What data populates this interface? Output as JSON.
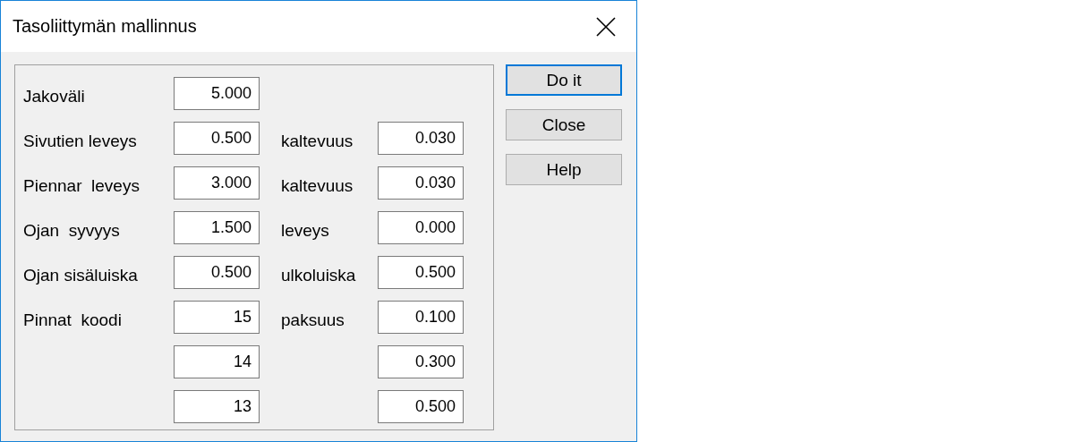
{
  "window": {
    "title": "Tasoliittymän mallinnus"
  },
  "rows": [
    {
      "label": "Jakoväli",
      "value": "5.000"
    },
    {
      "label": "Sivutien leveys",
      "value": "0.500",
      "label2": "kaltevuus",
      "value2": "0.030"
    },
    {
      "label": "Piennar  leveys",
      "value": "3.000",
      "label2": "kaltevuus",
      "value2": "0.030"
    },
    {
      "label": "Ojan  syvyys",
      "value": "1.500",
      "label2": "leveys",
      "value2": "0.000"
    },
    {
      "label": "Ojan sisäluiska",
      "value": "0.500",
      "label2": "ulkoluiska",
      "value2": "0.500"
    },
    {
      "label": "Pinnat  koodi",
      "value": "15",
      "label2": "paksuus",
      "value2": "0.100"
    },
    {
      "value": "14",
      "value2": "0.300"
    },
    {
      "value": "13",
      "value2": "0.500"
    }
  ],
  "buttons": [
    {
      "label": "Do it",
      "default": true
    },
    {
      "label": "Close",
      "default": false
    },
    {
      "label": "Help",
      "default": false
    }
  ]
}
